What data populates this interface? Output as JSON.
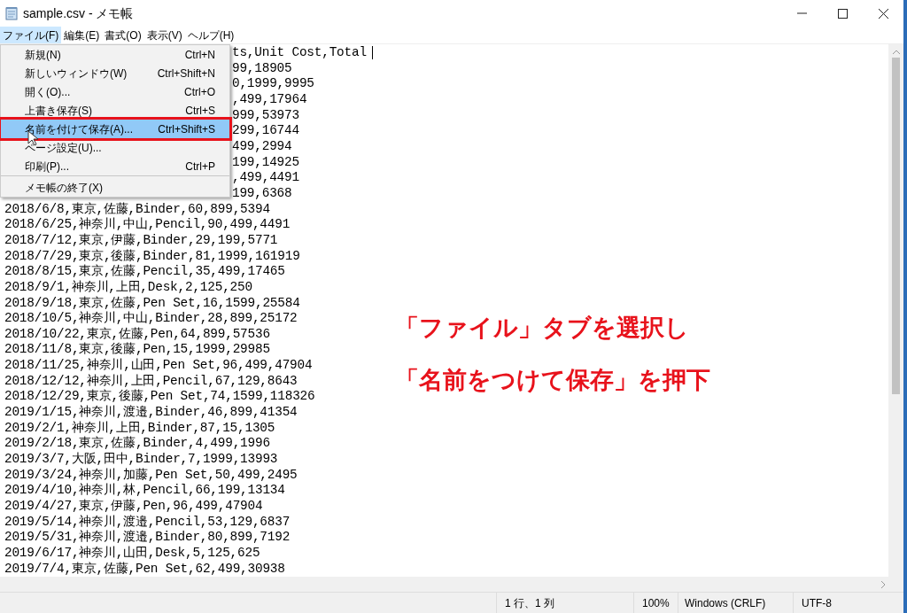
{
  "window": {
    "title": "sample.csv - メモ帳"
  },
  "menu_bar": [
    {
      "label": "ファイル(F)",
      "selected": true
    },
    {
      "label": "編集(E)",
      "selected": false
    },
    {
      "label": "書式(O)",
      "selected": false
    },
    {
      "label": "表示(V)",
      "selected": false
    },
    {
      "label": "ヘルプ(H)",
      "selected": false
    }
  ],
  "file_menu": [
    {
      "label": "新規(N)",
      "shortcut": "Ctrl+N",
      "selected": false,
      "separator_before": false
    },
    {
      "label": "新しいウィンドウ(W)",
      "shortcut": "Ctrl+Shift+N",
      "selected": false,
      "separator_before": false
    },
    {
      "label": "開く(O)...",
      "shortcut": "Ctrl+O",
      "selected": false,
      "separator_before": false
    },
    {
      "label": "上書き保存(S)",
      "shortcut": "Ctrl+S",
      "selected": false,
      "separator_before": false
    },
    {
      "label": "名前を付けて保存(A)...",
      "shortcut": "Ctrl+Shift+S",
      "selected": true,
      "separator_before": false
    },
    {
      "label": "ページ設定(U)...",
      "selected": false,
      "separator_before": false
    },
    {
      "label": "印刷(P)...",
      "shortcut": "Ctrl+P",
      "selected": false,
      "separator_before": false
    },
    {
      "label": "メモ帳の終了(X)",
      "selected": false,
      "separator_before": true
    }
  ],
  "document": {
    "lines": [
      {
        "kind": "partial",
        "text": "ts,Unit Cost,Total"
      },
      {
        "kind": "partial",
        "text": "99,18905"
      },
      {
        "kind": "partial",
        "text": "0,1999,9995"
      },
      {
        "kind": "partial",
        "text": ",499,17964"
      },
      {
        "kind": "partial",
        "text": "999,53973"
      },
      {
        "kind": "partial",
        "text": "299,16744"
      },
      {
        "kind": "partial",
        "text": "499,2994"
      },
      {
        "kind": "partial",
        "text": "199,14925"
      },
      {
        "kind": "partial",
        "text": ",499,4491"
      },
      {
        "kind": "partial",
        "text": "199,6368"
      },
      {
        "kind": "full",
        "text": "2018/6/8,東京,佐藤,Binder,60,899,5394"
      },
      {
        "kind": "full",
        "text": "2018/6/25,神奈川,中山,Pencil,90,499,4491"
      },
      {
        "kind": "full",
        "text": "2018/7/12,東京,伊藤,Binder,29,199,5771"
      },
      {
        "kind": "full",
        "text": "2018/7/29,東京,後藤,Binder,81,1999,161919"
      },
      {
        "kind": "full",
        "text": "2018/8/15,東京,佐藤,Pencil,35,499,17465"
      },
      {
        "kind": "full",
        "text": "2018/9/1,神奈川,上田,Desk,2,125,250"
      },
      {
        "kind": "full",
        "text": "2018/9/18,東京,佐藤,Pen Set,16,1599,25584"
      },
      {
        "kind": "full",
        "text": "2018/10/5,神奈川,中山,Binder,28,899,25172"
      },
      {
        "kind": "full",
        "text": "2018/10/22,東京,佐藤,Pen,64,899,57536"
      },
      {
        "kind": "full",
        "text": "2018/11/8,東京,後藤,Pen,15,1999,29985"
      },
      {
        "kind": "full",
        "text": "2018/11/25,神奈川,山田,Pen Set,96,499,47904"
      },
      {
        "kind": "full",
        "text": "2018/12/12,神奈川,上田,Pencil,67,129,8643"
      },
      {
        "kind": "full",
        "text": "2018/12/29,東京,後藤,Pen Set,74,1599,118326"
      },
      {
        "kind": "full",
        "text": "2019/1/15,神奈川,渡邉,Binder,46,899,41354"
      },
      {
        "kind": "full",
        "text": "2019/2/1,神奈川,上田,Binder,87,15,1305"
      },
      {
        "kind": "full",
        "text": "2019/2/18,東京,佐藤,Binder,4,499,1996"
      },
      {
        "kind": "full",
        "text": "2019/3/7,大阪,田中,Binder,7,1999,13993"
      },
      {
        "kind": "full",
        "text": "2019/3/24,神奈川,加藤,Pen Set,50,499,2495"
      },
      {
        "kind": "full",
        "text": "2019/4/10,神奈川,林,Pencil,66,199,13134"
      },
      {
        "kind": "full",
        "text": "2019/4/27,東京,伊藤,Pen,96,499,47904"
      },
      {
        "kind": "full",
        "text": "2019/5/14,神奈川,渡邉,Pencil,53,129,6837"
      },
      {
        "kind": "full",
        "text": "2019/5/31,神奈川,渡邉,Binder,80,899,7192"
      },
      {
        "kind": "full",
        "text": "2019/6/17,神奈川,山田,Desk,5,125,625"
      },
      {
        "kind": "full",
        "text": "2019/7/4,東京,佐藤,Pen Set,62,499,30938"
      }
    ]
  },
  "annotation": [
    "「ファイル」タブを選択し",
    "「名前をつけて保存」を押下"
  ],
  "status_bar": {
    "position": "1 行、1 列",
    "zoom": "100%",
    "line_ending": "Windows (CRLF)",
    "encoding": "UTF-8"
  }
}
